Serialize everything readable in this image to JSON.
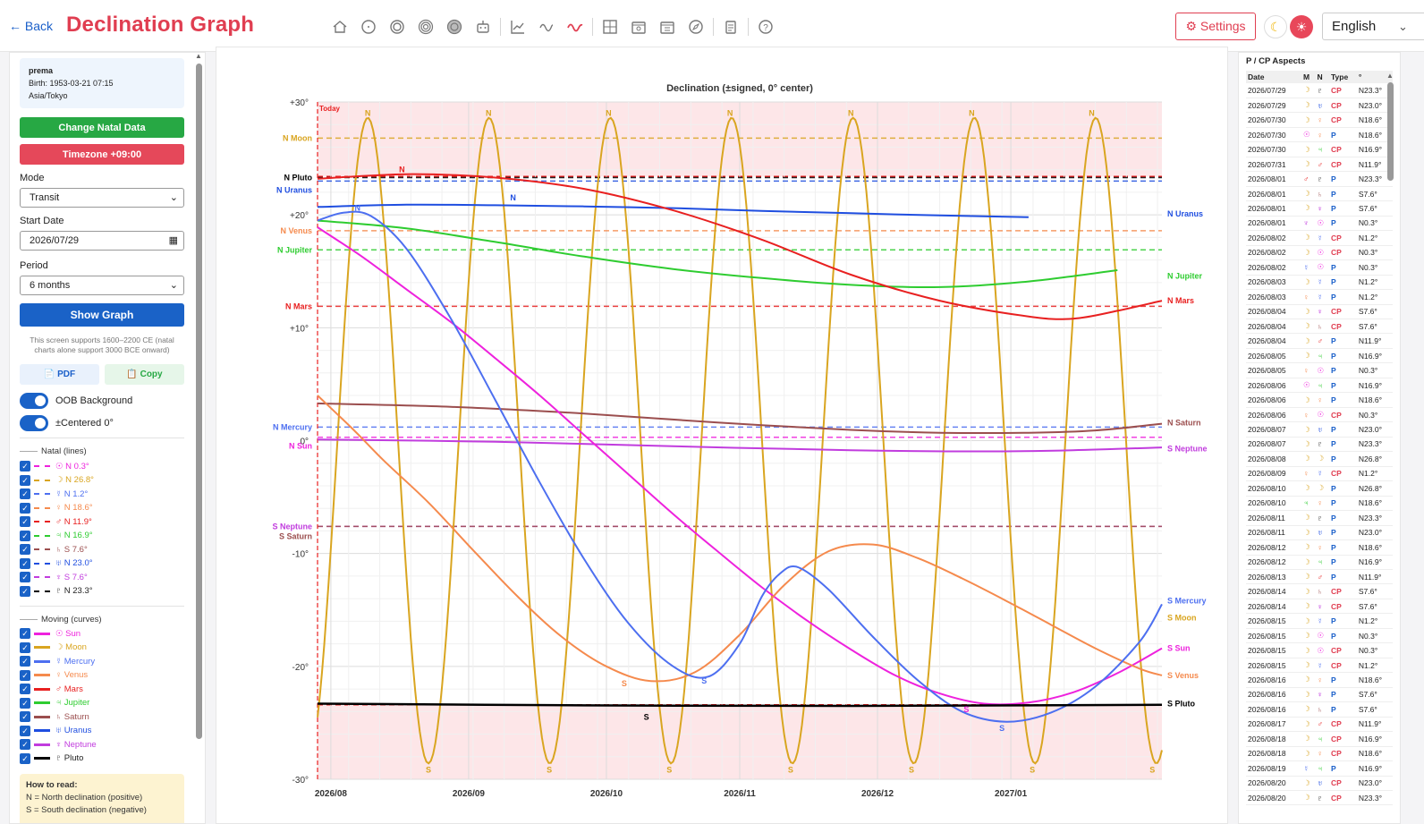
{
  "header": {
    "back_label": "← Back",
    "title": "Declination Graph",
    "toolbar_icons": [
      "home-icon",
      "circle-icon",
      "double-circle-icon",
      "triple-circle-icon",
      "filled-circle-icon",
      "robot-icon",
      "line-chart-icon",
      "wave-icon",
      "declination-wave-icon",
      "grid-chart-icon",
      "calendar-icon",
      "calendar-grid-icon",
      "compass-icon",
      "clipboard-icon",
      "help-icon"
    ],
    "settings_label": "⚙ Settings",
    "language": "English"
  },
  "left": {
    "natal": {
      "name": "prema",
      "birth": "Birth: 1953-03-21 07:15",
      "tz": "Asia/Tokyo"
    },
    "change_natal_label": "Change Natal Data",
    "timezone_label": "Timezone +09:00",
    "mode_label": "Mode",
    "mode_value": "Transit",
    "start_date_label": "Start Date",
    "start_date_value": "2026/07/29",
    "period_label": "Period",
    "period_value": "6 months",
    "show_graph_label": "Show Graph",
    "note": "This screen supports 1600–2200 CE (natal charts alone support 3000 BCE onward)",
    "pdf_label": "📄 PDF",
    "copy_label": "📋 Copy",
    "oob_label": "OOB Background",
    "centered_label": "±Centered 0°",
    "natal_section": "Natal (lines)",
    "natal_items": [
      {
        "label": "☉ N 0.3°",
        "color": "#ee22dd"
      },
      {
        "label": "☽ N 26.8°",
        "color": "#d9a520"
      },
      {
        "label": "☿ N 1.2°",
        "color": "#4d6ff0"
      },
      {
        "label": "♀ N 18.6°",
        "color": "#f58a4d"
      },
      {
        "label": "♂ N 11.9°",
        "color": "#e82020"
      },
      {
        "label": "♃ N 16.9°",
        "color": "#2ecc30"
      },
      {
        "label": "♄ S 7.6°",
        "color": "#9b4e4e"
      },
      {
        "label": "♅ N 23.0°",
        "color": "#1f4ee0"
      },
      {
        "label": "♆ S 7.6°",
        "color": "#c13cde"
      },
      {
        "label": "♇ N 23.3°",
        "color": "#000000"
      }
    ],
    "moving_section": "Moving (curves)",
    "moving_items": [
      {
        "label": "☉ Sun",
        "color": "#ee22dd"
      },
      {
        "label": "☽ Moon",
        "color": "#d9a520"
      },
      {
        "label": "☿ Mercury",
        "color": "#4d6ff0"
      },
      {
        "label": "♀ Venus",
        "color": "#f58a4d"
      },
      {
        "label": "♂ Mars",
        "color": "#e82020"
      },
      {
        "label": "♃ Jupiter",
        "color": "#2ecc30"
      },
      {
        "label": "♄ Saturn",
        "color": "#9b4e4e"
      },
      {
        "label": "♅ Uranus",
        "color": "#1f4ee0"
      },
      {
        "label": "♆ Neptune",
        "color": "#c13cde"
      },
      {
        "label": "♇ Pluto",
        "color": "#000000"
      }
    ],
    "how_title": "How to read:",
    "how_line1": "N = North declination (positive)",
    "how_line2": "S = South declination (negative)"
  },
  "chart_data": {
    "type": "line",
    "title": "Declination (±signed, 0° center)",
    "today_label": "Today",
    "x_ticks": [
      "2026/08",
      "2026/09",
      "2026/10",
      "2026/11",
      "2026/12",
      "2027/01"
    ],
    "ylim": [
      -30,
      30
    ],
    "y_ticks": [
      {
        "value": 30,
        "label": "+30°"
      },
      {
        "value": 20,
        "label": "+20°"
      },
      {
        "value": 10,
        "label": "+10°"
      },
      {
        "value": 0,
        "label": "0°"
      },
      {
        "value": -10,
        "label": "-10°"
      },
      {
        "value": -20,
        "label": "-20°"
      },
      {
        "value": -30,
        "label": "-30°"
      }
    ],
    "oob_threshold": 23.4,
    "natal_lines": [
      {
        "name": "N Moon",
        "value": 26.8,
        "color": "#d9a520"
      },
      {
        "name": "N Pluto",
        "value": 23.3,
        "color": "#000000"
      },
      {
        "name": "N Uranus",
        "value": 23.0,
        "color": "#1f4ee0"
      },
      {
        "name": "N Venus",
        "value": 18.6,
        "color": "#f58a4d"
      },
      {
        "name": "N Jupiter",
        "value": 16.9,
        "color": "#2ecc30"
      },
      {
        "name": "N Mars",
        "value": 11.9,
        "color": "#e82020"
      },
      {
        "name": "N Mercury",
        "value": 1.2,
        "color": "#4d6ff0"
      },
      {
        "name": "N Sun",
        "value": 0.3,
        "color": "#ee22dd"
      },
      {
        "name": "S Neptune",
        "value": -7.6,
        "color": "#c13cde"
      },
      {
        "name": "S Saturn",
        "value": -7.6,
        "color": "#9b4e4e"
      }
    ],
    "series": [
      {
        "name": "N Uranus",
        "color": "#1f4ee0",
        "points": [
          [
            0,
            20.7
          ],
          [
            20,
            20.9
          ],
          [
            40,
            20.85
          ],
          [
            60,
            20.75
          ],
          [
            80,
            20.6
          ],
          [
            100,
            20.35
          ],
          [
            120,
            20.15
          ],
          [
            140,
            19.95
          ],
          [
            160,
            19.8
          ]
        ]
      },
      {
        "name": "N Jupiter",
        "color": "#2ecc30",
        "points": [
          [
            0,
            19.5
          ],
          [
            20,
            18.8
          ],
          [
            40,
            17.6
          ],
          [
            60,
            16.3
          ],
          [
            80,
            15.2
          ],
          [
            100,
            14.4
          ],
          [
            120,
            13.8
          ],
          [
            140,
            13.6
          ],
          [
            160,
            14.1
          ],
          [
            180,
            15.1
          ]
        ]
      },
      {
        "name": "N Mars",
        "color": "#e82020",
        "points": [
          [
            0,
            23.2
          ],
          [
            20,
            23.6
          ],
          [
            40,
            23.3
          ],
          [
            60,
            22.3
          ],
          [
            80,
            20.4
          ],
          [
            100,
            17.8
          ],
          [
            120,
            14.7
          ],
          [
            140,
            12.4
          ],
          [
            160,
            11.0
          ],
          [
            170,
            10.8
          ],
          [
            180,
            11.5
          ],
          [
            190,
            12.4
          ]
        ]
      },
      {
        "name": "N Saturn",
        "color": "#9b4e4e",
        "points": [
          [
            0,
            3.3
          ],
          [
            30,
            3.0
          ],
          [
            60,
            2.4
          ],
          [
            90,
            1.6
          ],
          [
            120,
            0.95
          ],
          [
            140,
            0.7
          ],
          [
            160,
            0.7
          ],
          [
            175,
            0.9
          ],
          [
            190,
            1.5
          ]
        ]
      },
      {
        "name": "S Neptune",
        "color": "#c13cde",
        "points": [
          [
            0,
            0.1
          ],
          [
            40,
            -0.1
          ],
          [
            80,
            -0.5
          ],
          [
            120,
            -0.85
          ],
          [
            150,
            -0.95
          ],
          [
            170,
            -0.85
          ],
          [
            190,
            -0.6
          ]
        ]
      },
      {
        "name": "S Sun",
        "color": "#ee22dd",
        "points": [
          [
            0,
            18.9
          ],
          [
            10,
            16.3
          ],
          [
            20,
            13.4
          ],
          [
            30,
            10.5
          ],
          [
            40,
            7.3
          ],
          [
            50,
            4.0
          ],
          [
            60,
            0.5
          ],
          [
            70,
            -3.0
          ],
          [
            80,
            -6.5
          ],
          [
            90,
            -9.8
          ],
          [
            100,
            -13.0
          ],
          [
            110,
            -15.9
          ],
          [
            120,
            -18.5
          ],
          [
            130,
            -20.8
          ],
          [
            140,
            -22.4
          ],
          [
            150,
            -23.3
          ],
          [
            160,
            -23.2
          ],
          [
            170,
            -22.3
          ],
          [
            180,
            -20.6
          ],
          [
            190,
            -18.4
          ]
        ]
      },
      {
        "name": "S Venus",
        "color": "#f58a4d",
        "points": [
          [
            0,
            4.0
          ],
          [
            8,
            1.0
          ],
          [
            15,
            -1.8
          ],
          [
            25,
            -5.5
          ],
          [
            35,
            -9.7
          ],
          [
            45,
            -13.8
          ],
          [
            55,
            -17.4
          ],
          [
            65,
            -20.0
          ],
          [
            75,
            -21.3
          ],
          [
            85,
            -20.5
          ],
          [
            95,
            -17.2
          ],
          [
            105,
            -12.8
          ],
          [
            115,
            -9.8
          ],
          [
            125,
            -9.2
          ],
          [
            135,
            -10.4
          ],
          [
            145,
            -12.2
          ],
          [
            155,
            -14.2
          ],
          [
            165,
            -16.3
          ],
          [
            175,
            -18.4
          ],
          [
            185,
            -20.2
          ],
          [
            190,
            -20.8
          ]
        ]
      },
      {
        "name": "S Mercury",
        "color": "#4d6ff0",
        "points": [
          [
            0,
            19.5
          ],
          [
            6,
            20.2
          ],
          [
            12,
            19.9
          ],
          [
            20,
            17.0
          ],
          [
            30,
            10.8
          ],
          [
            40,
            3.6
          ],
          [
            50,
            -3.7
          ],
          [
            60,
            -10.5
          ],
          [
            70,
            -16.2
          ],
          [
            80,
            -20.0
          ],
          [
            88,
            -20.9
          ],
          [
            95,
            -18.0
          ],
          [
            100,
            -13.8
          ],
          [
            104,
            -11.8
          ],
          [
            108,
            -11.2
          ],
          [
            115,
            -13.2
          ],
          [
            125,
            -17.4
          ],
          [
            135,
            -21.2
          ],
          [
            145,
            -24.0
          ],
          [
            155,
            -24.9
          ],
          [
            165,
            -24.1
          ],
          [
            175,
            -21.8
          ],
          [
            185,
            -17.8
          ],
          [
            190,
            -14.5
          ]
        ]
      },
      {
        "name": "S Pluto",
        "color": "#000000",
        "points": [
          [
            0,
            -23.3
          ],
          [
            60,
            -23.45
          ],
          [
            120,
            -23.5
          ],
          [
            160,
            -23.45
          ],
          [
            190,
            -23.4
          ]
        ]
      }
    ],
    "moon_peak_days": [
      11.3,
      38.5,
      65.5,
      92.8,
      120.0,
      147.2,
      174.2
    ],
    "moon_amplitude": 28.6,
    "moon_period_days": 27.3,
    "series_markers": [
      {
        "text": "N",
        "day": 19,
        "value": 24.0,
        "color": "#e82020"
      },
      {
        "text": "N",
        "day": 44,
        "value": 21.5,
        "color": "#1f4ee0"
      },
      {
        "text": "N",
        "day": 9,
        "value": 20.6,
        "color": "#4d6ff0"
      },
      {
        "text": "S",
        "day": 69,
        "value": -21.5,
        "color": "#f58a4d"
      },
      {
        "text": "S",
        "day": 87,
        "value": -21.3,
        "color": "#4d6ff0"
      },
      {
        "text": "S",
        "day": 74,
        "value": -24.5,
        "color": "#000000"
      },
      {
        "text": "S",
        "day": 146,
        "value": -23.8,
        "color": "#ee22dd"
      },
      {
        "text": "S",
        "day": 154,
        "value": -25.5,
        "color": "#4d6ff0"
      }
    ],
    "right_labels": [
      {
        "name": "N Uranus",
        "value": 20.1,
        "color": "#1f4ee0"
      },
      {
        "name": "N Jupiter",
        "value": 14.6,
        "color": "#2ecc30"
      },
      {
        "name": "N Mars",
        "value": 12.4,
        "color": "#e82020"
      },
      {
        "name": "N Saturn",
        "value": 1.6,
        "color": "#9b4e4e"
      },
      {
        "name": "S Neptune",
        "value": -0.7,
        "color": "#c13cde"
      },
      {
        "name": "S Mercury",
        "value": -14.2,
        "color": "#4d6ff0"
      },
      {
        "name": "S Moon",
        "value": -15.7,
        "color": "#d9a520"
      },
      {
        "name": "S Sun",
        "value": -18.4,
        "color": "#ee22dd"
      },
      {
        "name": "S Venus",
        "value": -20.8,
        "color": "#f58a4d"
      },
      {
        "name": "S Pluto",
        "value": -23.3,
        "color": "#000000"
      }
    ]
  },
  "aspects": {
    "title": "P / CP Aspects",
    "headers": [
      "Date",
      "M",
      "N",
      "Type",
      "°"
    ],
    "rows": [
      [
        "2026/07/29",
        "☽",
        "♇",
        "CP",
        "N23.3°"
      ],
      [
        "2026/07/29",
        "☽",
        "♅",
        "CP",
        "N23.0°"
      ],
      [
        "2026/07/30",
        "☽",
        "♀",
        "CP",
        "N18.6°"
      ],
      [
        "2026/07/30",
        "☉",
        "♀",
        "P",
        "N18.6°"
      ],
      [
        "2026/07/30",
        "☽",
        "♃",
        "CP",
        "N16.9°"
      ],
      [
        "2026/07/31",
        "☽",
        "♂",
        "CP",
        "N11.9°"
      ],
      [
        "2026/08/01",
        "♂",
        "♇",
        "P",
        "N23.3°"
      ],
      [
        "2026/08/01",
        "☽",
        "♄",
        "P",
        "S7.6°"
      ],
      [
        "2026/08/01",
        "☽",
        "♆",
        "P",
        "S7.6°"
      ],
      [
        "2026/08/01",
        "♆",
        "☉",
        "P",
        "N0.3°"
      ],
      [
        "2026/08/02",
        "☽",
        "☿",
        "CP",
        "N1.2°"
      ],
      [
        "2026/08/02",
        "☽",
        "☉",
        "CP",
        "N0.3°"
      ],
      [
        "2026/08/02",
        "☿",
        "☉",
        "P",
        "N0.3°"
      ],
      [
        "2026/08/03",
        "☽",
        "☿",
        "P",
        "N1.2°"
      ],
      [
        "2026/08/03",
        "♀",
        "☿",
        "P",
        "N1.2°"
      ],
      [
        "2026/08/04",
        "☽",
        "♆",
        "CP",
        "S7.6°"
      ],
      [
        "2026/08/04",
        "☽",
        "♄",
        "CP",
        "S7.6°"
      ],
      [
        "2026/08/04",
        "☽",
        "♂",
        "P",
        "N11.9°"
      ],
      [
        "2026/08/05",
        "☽",
        "♃",
        "P",
        "N16.9°"
      ],
      [
        "2026/08/05",
        "♀",
        "☉",
        "P",
        "N0.3°"
      ],
      [
        "2026/08/06",
        "☉",
        "♃",
        "P",
        "N16.9°"
      ],
      [
        "2026/08/06",
        "☽",
        "♀",
        "P",
        "N18.6°"
      ],
      [
        "2026/08/06",
        "♀",
        "☉",
        "CP",
        "N0.3°"
      ],
      [
        "2026/08/07",
        "☽",
        "♅",
        "P",
        "N23.0°"
      ],
      [
        "2026/08/07",
        "☽",
        "♇",
        "P",
        "N23.3°"
      ],
      [
        "2026/08/08",
        "☽",
        "☽",
        "P",
        "N26.8°"
      ],
      [
        "2026/08/09",
        "♀",
        "☿",
        "CP",
        "N1.2°"
      ],
      [
        "2026/08/10",
        "☽",
        "☽",
        "P",
        "N26.8°"
      ],
      [
        "2026/08/10",
        "♃",
        "♀",
        "P",
        "N18.6°"
      ],
      [
        "2026/08/11",
        "☽",
        "♇",
        "P",
        "N23.3°"
      ],
      [
        "2026/08/11",
        "☽",
        "♅",
        "P",
        "N23.0°"
      ],
      [
        "2026/08/12",
        "☽",
        "♀",
        "P",
        "N18.6°"
      ],
      [
        "2026/08/12",
        "☽",
        "♃",
        "P",
        "N16.9°"
      ],
      [
        "2026/08/13",
        "☽",
        "♂",
        "P",
        "N11.9°"
      ],
      [
        "2026/08/14",
        "☽",
        "♄",
        "CP",
        "S7.6°"
      ],
      [
        "2026/08/14",
        "☽",
        "♆",
        "CP",
        "S7.6°"
      ],
      [
        "2026/08/15",
        "☽",
        "☿",
        "P",
        "N1.2°"
      ],
      [
        "2026/08/15",
        "☽",
        "☉",
        "P",
        "N0.3°"
      ],
      [
        "2026/08/15",
        "☽",
        "☉",
        "CP",
        "N0.3°"
      ],
      [
        "2026/08/15",
        "☽",
        "☿",
        "CP",
        "N1.2°"
      ],
      [
        "2026/08/16",
        "☽",
        "♀",
        "P",
        "N18.6°"
      ],
      [
        "2026/08/16",
        "☽",
        "♆",
        "P",
        "S7.6°"
      ],
      [
        "2026/08/16",
        "☽",
        "♄",
        "P",
        "S7.6°"
      ],
      [
        "2026/08/17",
        "☽",
        "♂",
        "CP",
        "N11.9°"
      ],
      [
        "2026/08/18",
        "☽",
        "♃",
        "CP",
        "N16.9°"
      ],
      [
        "2026/08/18",
        "☽",
        "♀",
        "CP",
        "N18.6°"
      ],
      [
        "2026/08/19",
        "☿",
        "♃",
        "P",
        "N16.9°"
      ],
      [
        "2026/08/20",
        "☽",
        "♅",
        "CP",
        "N23.0°"
      ],
      [
        "2026/08/20",
        "☽",
        "♇",
        "CP",
        "N23.3°"
      ]
    ]
  }
}
